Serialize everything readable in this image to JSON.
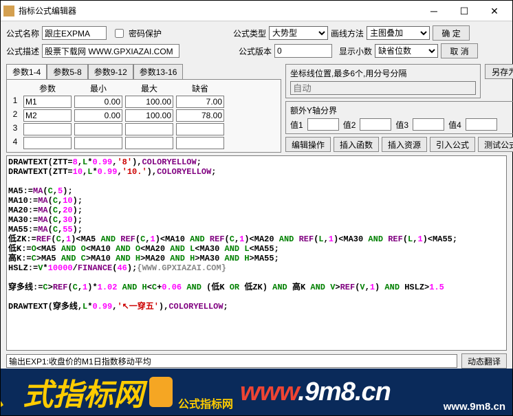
{
  "window": {
    "title": "指标公式编辑器"
  },
  "labels": {
    "name": "公式名称",
    "pwd": "密码保护",
    "type": "公式类型",
    "draw": "画线方法",
    "desc": "公式描述",
    "ver": "公式版本",
    "dec": "显示小数",
    "ok": "确  定",
    "cancel": "取  消",
    "saveas": "另存为",
    "editop": "编辑操作",
    "insfn": "插入函数",
    "insres": "插入资源",
    "import": "引入公式",
    "test": "测试公式",
    "dyn": "动态翻译",
    "cross_title": "坐标线位置,最多6个,用分号分隔",
    "cross_ph": "自动",
    "yaxis_title": "额外Y轴分界",
    "y1": "值1",
    "y2": "值2",
    "y3": "值3",
    "y4": "值4"
  },
  "fields": {
    "name": "跟庄EXPMA",
    "desc": "股票下载网 WWW.GPXIAZAI.COM",
    "ver": "0",
    "type_opt": "大势型",
    "draw_opt": "主图叠加",
    "dec_opt": "缺省位数"
  },
  "tabs": [
    "参数1-4",
    "参数5-8",
    "参数9-12",
    "参数13-16"
  ],
  "param_headers": {
    "name": "参数",
    "min": "最小",
    "max": "最大",
    "def": "缺省"
  },
  "params": [
    {
      "n": "1",
      "name": "M1",
      "min": "0.00",
      "max": "100.00",
      "def": "7.00"
    },
    {
      "n": "2",
      "name": "M2",
      "min": "0.00",
      "max": "100.00",
      "def": "78.00"
    },
    {
      "n": "3",
      "name": "",
      "min": "",
      "max": "",
      "def": ""
    },
    {
      "n": "4",
      "name": "",
      "min": "",
      "max": "",
      "def": ""
    }
  ],
  "status": "输出EXP1:收盘价的M1日指数移动平均",
  "chart_data": {
    "type": "table",
    "note": "source code lines of the formula editor with syntax-color roles",
    "lines": [
      [
        [
          "nm",
          "DRAWTEXT"
        ],
        [
          "nm",
          "("
        ],
        [
          "nm",
          "ZTT"
        ],
        [
          "nm",
          "="
        ],
        [
          "num",
          "8"
        ],
        [
          "nm",
          ","
        ],
        [
          "kw",
          "L"
        ],
        [
          "nm",
          "*"
        ],
        [
          "num",
          "0.99"
        ],
        [
          "nm",
          ","
        ],
        [
          "str",
          "'8'"
        ],
        [
          "nm",
          ")"
        ],
        [
          "nm",
          ","
        ],
        [
          "fn",
          "COLORYELLOW"
        ],
        [
          "nm",
          ";"
        ]
      ],
      [
        [
          "nm",
          "DRAWTEXT"
        ],
        [
          "nm",
          "("
        ],
        [
          "nm",
          "ZTT"
        ],
        [
          "nm",
          "="
        ],
        [
          "num",
          "10"
        ],
        [
          "nm",
          ","
        ],
        [
          "kw",
          "L"
        ],
        [
          "nm",
          "*"
        ],
        [
          "num",
          "0.99"
        ],
        [
          "nm",
          ","
        ],
        [
          "str",
          "'10.'"
        ],
        [
          "nm",
          ")"
        ],
        [
          "nm",
          ","
        ],
        [
          "fn",
          "COLORYELLOW"
        ],
        [
          "nm",
          ";"
        ]
      ],
      [],
      [
        [
          "nm",
          "MA5"
        ],
        [
          "nm",
          ":="
        ],
        [
          "fn",
          "MA"
        ],
        [
          "nm",
          "("
        ],
        [
          "kw",
          "C"
        ],
        [
          "nm",
          ","
        ],
        [
          "num",
          "5"
        ],
        [
          "nm",
          ")"
        ],
        [
          "nm",
          ";"
        ]
      ],
      [
        [
          "nm",
          "MA10"
        ],
        [
          "nm",
          ":="
        ],
        [
          "fn",
          "MA"
        ],
        [
          "nm",
          "("
        ],
        [
          "kw",
          "C"
        ],
        [
          "nm",
          ","
        ],
        [
          "num",
          "10"
        ],
        [
          "nm",
          ")"
        ],
        [
          "nm",
          ";"
        ]
      ],
      [
        [
          "nm",
          "MA20"
        ],
        [
          "nm",
          ":="
        ],
        [
          "fn",
          "MA"
        ],
        [
          "nm",
          "("
        ],
        [
          "kw",
          "C"
        ],
        [
          "nm",
          ","
        ],
        [
          "num",
          "20"
        ],
        [
          "nm",
          ")"
        ],
        [
          "nm",
          ";"
        ]
      ],
      [
        [
          "nm",
          "MA30"
        ],
        [
          "nm",
          ":="
        ],
        [
          "fn",
          "MA"
        ],
        [
          "nm",
          "("
        ],
        [
          "kw",
          "C"
        ],
        [
          "nm",
          ","
        ],
        [
          "num",
          "30"
        ],
        [
          "nm",
          ")"
        ],
        [
          "nm",
          ";"
        ]
      ],
      [
        [
          "nm",
          "MA55"
        ],
        [
          "nm",
          ":="
        ],
        [
          "fn",
          "MA"
        ],
        [
          "nm",
          "("
        ],
        [
          "kw",
          "C"
        ],
        [
          "nm",
          ","
        ],
        [
          "num",
          "55"
        ],
        [
          "nm",
          ")"
        ],
        [
          "nm",
          ";"
        ]
      ],
      [
        [
          "nm",
          "低ZK"
        ],
        [
          "nm",
          ":="
        ],
        [
          "fn",
          "REF"
        ],
        [
          "nm",
          "("
        ],
        [
          "kw",
          "C"
        ],
        [
          "nm",
          ","
        ],
        [
          "num",
          "1"
        ],
        [
          "nm",
          ")<"
        ],
        [
          "nm",
          "MA5"
        ],
        [
          "nm",
          " "
        ],
        [
          "kw",
          "AND"
        ],
        [
          "nm",
          " "
        ],
        [
          "fn",
          "REF"
        ],
        [
          "nm",
          "("
        ],
        [
          "kw",
          "C"
        ],
        [
          "nm",
          ","
        ],
        [
          "num",
          "1"
        ],
        [
          "nm",
          ")<"
        ],
        [
          "nm",
          "MA10"
        ],
        [
          "nm",
          " "
        ],
        [
          "kw",
          "AND"
        ],
        [
          "nm",
          " "
        ],
        [
          "fn",
          "REF"
        ],
        [
          "nm",
          "("
        ],
        [
          "kw",
          "C"
        ],
        [
          "nm",
          ","
        ],
        [
          "num",
          "1"
        ],
        [
          "nm",
          ")<"
        ],
        [
          "nm",
          "MA20"
        ],
        [
          "nm",
          " "
        ],
        [
          "kw",
          "AND"
        ],
        [
          "nm",
          " "
        ],
        [
          "fn",
          "REF"
        ],
        [
          "nm",
          "("
        ],
        [
          "kw",
          "L"
        ],
        [
          "nm",
          ","
        ],
        [
          "num",
          "1"
        ],
        [
          "nm",
          ")<"
        ],
        [
          "nm",
          "MA30"
        ],
        [
          "nm",
          " "
        ],
        [
          "kw",
          "AND"
        ],
        [
          "nm",
          " "
        ],
        [
          "fn",
          "REF"
        ],
        [
          "nm",
          "("
        ],
        [
          "kw",
          "L"
        ],
        [
          "nm",
          ","
        ],
        [
          "num",
          "1"
        ],
        [
          "nm",
          ")<"
        ],
        [
          "nm",
          "MA55"
        ],
        [
          "nm",
          ";"
        ]
      ],
      [
        [
          "nm",
          "低K"
        ],
        [
          "nm",
          ":="
        ],
        [
          "kw",
          "O"
        ],
        [
          "nm",
          "<"
        ],
        [
          "nm",
          "MA5"
        ],
        [
          "nm",
          " "
        ],
        [
          "kw",
          "AND"
        ],
        [
          "nm",
          " "
        ],
        [
          "kw",
          "O"
        ],
        [
          "nm",
          "<"
        ],
        [
          "nm",
          "MA10"
        ],
        [
          "nm",
          " "
        ],
        [
          "kw",
          "AND"
        ],
        [
          "nm",
          " "
        ],
        [
          "kw",
          "O"
        ],
        [
          "nm",
          "<"
        ],
        [
          "nm",
          "MA20"
        ],
        [
          "nm",
          " "
        ],
        [
          "kw",
          "AND"
        ],
        [
          "nm",
          " "
        ],
        [
          "kw",
          "L"
        ],
        [
          "nm",
          "<"
        ],
        [
          "nm",
          "MA30"
        ],
        [
          "nm",
          " "
        ],
        [
          "kw",
          "AND"
        ],
        [
          "nm",
          " "
        ],
        [
          "kw",
          "L"
        ],
        [
          "nm",
          "<"
        ],
        [
          "nm",
          "MA55"
        ],
        [
          "nm",
          ";"
        ]
      ],
      [
        [
          "nm",
          "高K"
        ],
        [
          "nm",
          ":="
        ],
        [
          "kw",
          "C"
        ],
        [
          "nm",
          ">"
        ],
        [
          "nm",
          "MA5"
        ],
        [
          "nm",
          " "
        ],
        [
          "kw",
          "AND"
        ],
        [
          "nm",
          " "
        ],
        [
          "kw",
          "C"
        ],
        [
          "nm",
          ">"
        ],
        [
          "nm",
          "MA10"
        ],
        [
          "nm",
          " "
        ],
        [
          "kw",
          "AND"
        ],
        [
          "nm",
          " "
        ],
        [
          "kw",
          "H"
        ],
        [
          "nm",
          ">"
        ],
        [
          "nm",
          "MA20"
        ],
        [
          "nm",
          " "
        ],
        [
          "kw",
          "AND"
        ],
        [
          "nm",
          " "
        ],
        [
          "kw",
          "H"
        ],
        [
          "nm",
          ">"
        ],
        [
          "nm",
          "MA30"
        ],
        [
          "nm",
          " "
        ],
        [
          "kw",
          "AND"
        ],
        [
          "nm",
          " "
        ],
        [
          "kw",
          "H"
        ],
        [
          "nm",
          ">"
        ],
        [
          "nm",
          "MA55"
        ],
        [
          "nm",
          ";"
        ]
      ],
      [
        [
          "nm",
          "HSLZ"
        ],
        [
          "nm",
          ":="
        ],
        [
          "kw",
          "V"
        ],
        [
          "nm",
          "*"
        ],
        [
          "num",
          "10000"
        ],
        [
          "nm",
          "/"
        ],
        [
          "fn",
          "FINANCE"
        ],
        [
          "nm",
          "("
        ],
        [
          "num",
          "46"
        ],
        [
          "nm",
          ")"
        ],
        [
          "nm",
          ";"
        ],
        [
          "com",
          "{WWW.GPXIAZAI.COM}"
        ]
      ],
      [],
      [
        [
          "nm",
          "穿多线"
        ],
        [
          "nm",
          ":="
        ],
        [
          "kw",
          "C"
        ],
        [
          "nm",
          ">"
        ],
        [
          "fn",
          "REF"
        ],
        [
          "nm",
          "("
        ],
        [
          "kw",
          "C"
        ],
        [
          "nm",
          ","
        ],
        [
          "num",
          "1"
        ],
        [
          "nm",
          ")*"
        ],
        [
          "num",
          "1.02"
        ],
        [
          "nm",
          " "
        ],
        [
          "kw",
          "AND"
        ],
        [
          "nm",
          " "
        ],
        [
          "kw",
          "H"
        ],
        [
          "nm",
          "<"
        ],
        [
          "kw",
          "C"
        ],
        [
          "nm",
          "+"
        ],
        [
          "num",
          "0.06"
        ],
        [
          "nm",
          " "
        ],
        [
          "kw",
          "AND"
        ],
        [
          "nm",
          " ("
        ],
        [
          "nm",
          "低K"
        ],
        [
          "nm",
          " "
        ],
        [
          "kw",
          "OR"
        ],
        [
          "nm",
          " "
        ],
        [
          "nm",
          "低ZK"
        ],
        [
          "nm",
          ") "
        ],
        [
          "kw",
          "AND"
        ],
        [
          "nm",
          " "
        ],
        [
          "nm",
          "高K"
        ],
        [
          "nm",
          " "
        ],
        [
          "kw",
          "AND"
        ],
        [
          "nm",
          " "
        ],
        [
          "kw",
          "V"
        ],
        [
          "nm",
          ">"
        ],
        [
          "fn",
          "REF"
        ],
        [
          "nm",
          "("
        ],
        [
          "kw",
          "V"
        ],
        [
          "nm",
          ","
        ],
        [
          "num",
          "1"
        ],
        [
          "nm",
          ") "
        ],
        [
          "kw",
          "AND"
        ],
        [
          "nm",
          " "
        ],
        [
          "nm",
          "HSLZ"
        ],
        [
          "nm",
          ">"
        ],
        [
          "num",
          "1.5"
        ]
      ],
      [],
      [
        [
          "nm",
          "DRAWTEXT"
        ],
        [
          "nm",
          "("
        ],
        [
          "nm",
          "穿多线"
        ],
        [
          "nm",
          ","
        ],
        [
          "kw",
          "L"
        ],
        [
          "nm",
          "*"
        ],
        [
          "num",
          "0.99"
        ],
        [
          "nm",
          ","
        ],
        [
          "str",
          "'↖一穿五'"
        ],
        [
          "nm",
          ")"
        ],
        [
          "nm",
          ","
        ],
        [
          "fn",
          "COLORYELLOW"
        ],
        [
          "nm",
          ";"
        ]
      ]
    ]
  },
  "footer": {
    "cn": "、式指标网",
    "sub": "公式指标网",
    "url_big_w": "www",
    "url_big_rest": ".9m8.cn",
    "url_small": "www.9m8.cn"
  }
}
